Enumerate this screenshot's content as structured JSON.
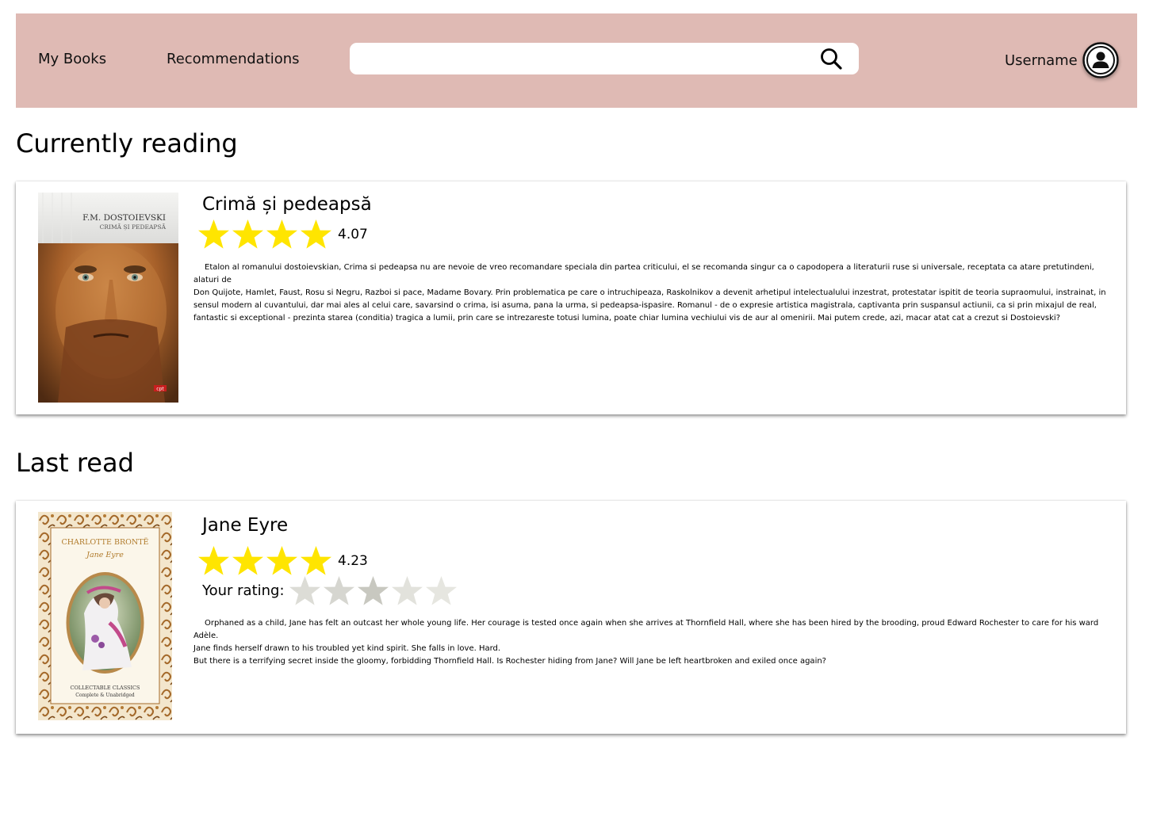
{
  "header": {
    "nav": [
      {
        "label": "My Books"
      },
      {
        "label": "Recommendations"
      }
    ],
    "search": {
      "placeholder": "",
      "value": "",
      "icon": "search-icon"
    },
    "username": "Username",
    "avatar_icon": "user-avatar-icon"
  },
  "colors": {
    "header_bg": "#dfbab4",
    "star_filled": "#ffe500",
    "star_empty": "#d9d9d2"
  },
  "currently_reading": {
    "title": "Currently reading",
    "book": {
      "title": "Crimă și pedeapsă",
      "rating": "4.07",
      "cover_author": "F.M. DOSTOIEVSKI",
      "cover_title": "CRIMĂ ȘI PEDEAPSĂ",
      "cover_publisher": "cpt",
      "description": "Etalon al romanului dostoievskian, Crima si pedeapsa nu are nevoie de vreo recomandare speciala din partea criticului, el se recomanda singur ca o capodopera a literaturii ruse si universale, receptata ca atare pretutindeni, alaturi de\nDon Quijote, Hamlet, Faust, Rosu si Negru, Razboi si pace, Madame Bovary. Prin problematica pe care o intruchipeaza, Raskolnikov a devenit arhetipul intelectualului inzestrat, protestatar ispitit de teoria supraomului, instrainat, in sensul modern al cuvantului, dar mai ales al celui care, savarsind o crima, isi asuma, pana la urma, si pedeapsa-ispasire. Romanul - de o expresie artistica magistrala, captivanta prin suspansul actiunii, ca si prin mixajul de real, fantastic si exceptional - prezinta starea (conditia) tragica a lumii, prin care se intrezareste totusi lumina, poate chiar lumina vechiului vis de aur al omenirii. Mai putem crede, azi, macar atat cat a crezut si Dostoievski?"
    }
  },
  "last_read": {
    "title": "Last read",
    "book": {
      "title": "Jane Eyre",
      "rating": "4.23",
      "your_rating_label": "Your rating:",
      "cover_author": "CHARLOTTE BRONTË",
      "cover_title": "Jane Eyre",
      "cover_series": "COLLECTABLE CLASSICS",
      "cover_edition": "Complete & Unabridged",
      "description": "Orphaned as a child, Jane has felt an outcast her whole young life. Her courage is tested once again when she arrives at Thornfield Hall, where she has been hired by the brooding, proud Edward Rochester to care for his ward Adèle.\nJane finds herself drawn to his troubled yet kind spirit. She falls in love. Hard.\nBut there is a terrifying secret inside the gloomy, forbidding Thornfield Hall. Is Rochester hiding from Jane? Will Jane be left heartbroken and exiled once again?"
    }
  }
}
